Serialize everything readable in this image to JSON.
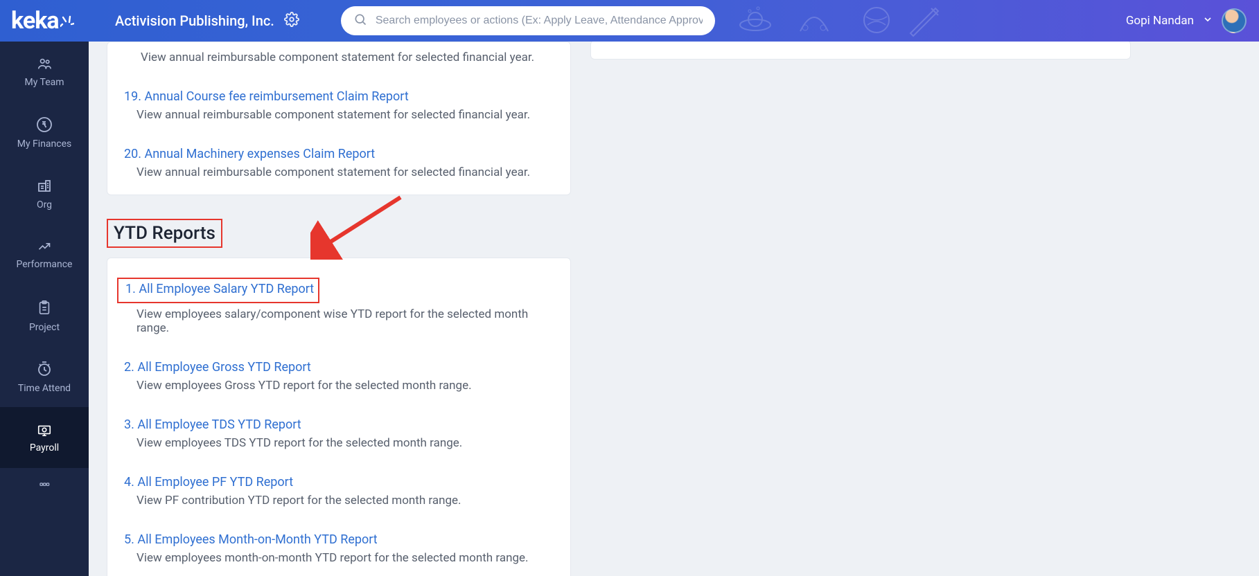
{
  "brand": "keka",
  "company_name": "Activision Publishing, Inc.",
  "search": {
    "placeholder": "Search employees or actions (Ex: Apply Leave, Attendance Approvals)"
  },
  "user": {
    "name": "Gopi Nandan"
  },
  "sidebar": {
    "items": [
      {
        "label": "My Team"
      },
      {
        "label": "My Finances"
      },
      {
        "label": "Org"
      },
      {
        "label": "Performance"
      },
      {
        "label": "Project"
      },
      {
        "label": "Time Attend"
      },
      {
        "label": "Payroll"
      }
    ]
  },
  "top_card": {
    "items": [
      {
        "num": "",
        "title": "",
        "desc": "View annual reimbursable component statement for selected financial year."
      },
      {
        "num": "19.",
        "title": "Annual Course fee reimbursement Claim Report",
        "desc": "View annual reimbursable component statement for selected financial year."
      },
      {
        "num": "20.",
        "title": "Annual Machinery expenses Claim Report",
        "desc": "View annual reimbursable component statement for selected financial year."
      }
    ]
  },
  "ytd": {
    "section_title": "YTD Reports",
    "items": [
      {
        "num": "1.",
        "title": "All Employee Salary YTD Report",
        "desc": "View employees salary/component wise YTD report for the selected month range."
      },
      {
        "num": "2.",
        "title": "All Employee Gross YTD Report",
        "desc": "View employees Gross YTD report for the selected month range."
      },
      {
        "num": "3.",
        "title": "All Employee TDS YTD Report",
        "desc": "View employees TDS YTD report for the selected month range."
      },
      {
        "num": "4.",
        "title": "All Employee PF YTD Report",
        "desc": "View PF contribution YTD report for the selected month range."
      },
      {
        "num": "5.",
        "title": "All Employees Month-on-Month YTD Report",
        "desc": "View employees month-on-month YTD report for the selected month range."
      }
    ]
  },
  "colors": {
    "link": "#2f6fd1",
    "highlight": "#e6362d"
  }
}
